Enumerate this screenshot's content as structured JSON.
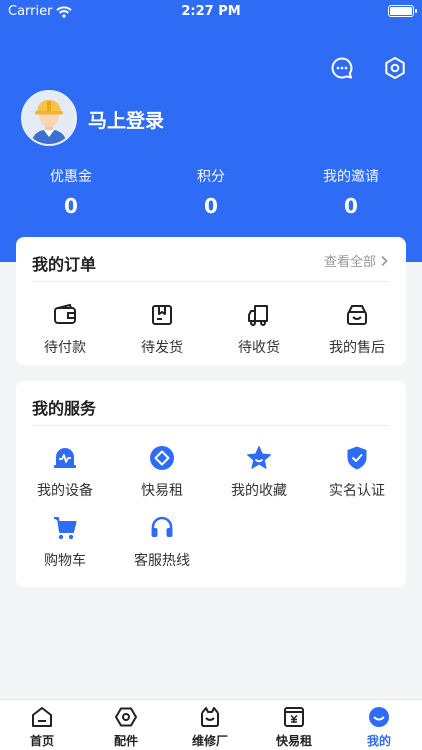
{
  "status_bar": {
    "carrier": "Carrier",
    "time": "2:27 PM"
  },
  "header": {
    "login_text": "马上登录",
    "stats": [
      {
        "label": "优惠金",
        "value": "0"
      },
      {
        "label": "积分",
        "value": "0"
      },
      {
        "label": "我的邀请",
        "value": "0"
      }
    ]
  },
  "orders": {
    "title": "我的订单",
    "view_all": "查看全部",
    "items": [
      {
        "label": "待付款",
        "icon": "wallet-icon"
      },
      {
        "label": "待发货",
        "icon": "package-icon"
      },
      {
        "label": "待收货",
        "icon": "truck-icon"
      },
      {
        "label": "我的售后",
        "icon": "after-sales-box-icon"
      }
    ]
  },
  "services": {
    "title": "我的服务",
    "items": [
      {
        "label": "我的设备",
        "icon": "device-monitor-icon"
      },
      {
        "label": "快易租",
        "icon": "rent-diamond-icon"
      },
      {
        "label": "我的收藏",
        "icon": "star-icon"
      },
      {
        "label": "实名认证",
        "icon": "shield-check-icon"
      },
      {
        "label": "购物车",
        "icon": "cart-icon"
      },
      {
        "label": "客服热线",
        "icon": "headset-icon"
      }
    ]
  },
  "tabbar": {
    "items": [
      {
        "label": "首页",
        "icon": "home-icon"
      },
      {
        "label": "配件",
        "icon": "parts-hex-icon"
      },
      {
        "label": "维修厂",
        "icon": "repair-shop-icon"
      },
      {
        "label": "快易租",
        "icon": "rent-tab-icon"
      },
      {
        "label": "我的",
        "icon": "profile-icon",
        "active": true
      }
    ]
  },
  "colors": {
    "brand": "#2f6cf6",
    "background": "#f4f5f7",
    "text": "#222222",
    "muted": "#999999"
  }
}
